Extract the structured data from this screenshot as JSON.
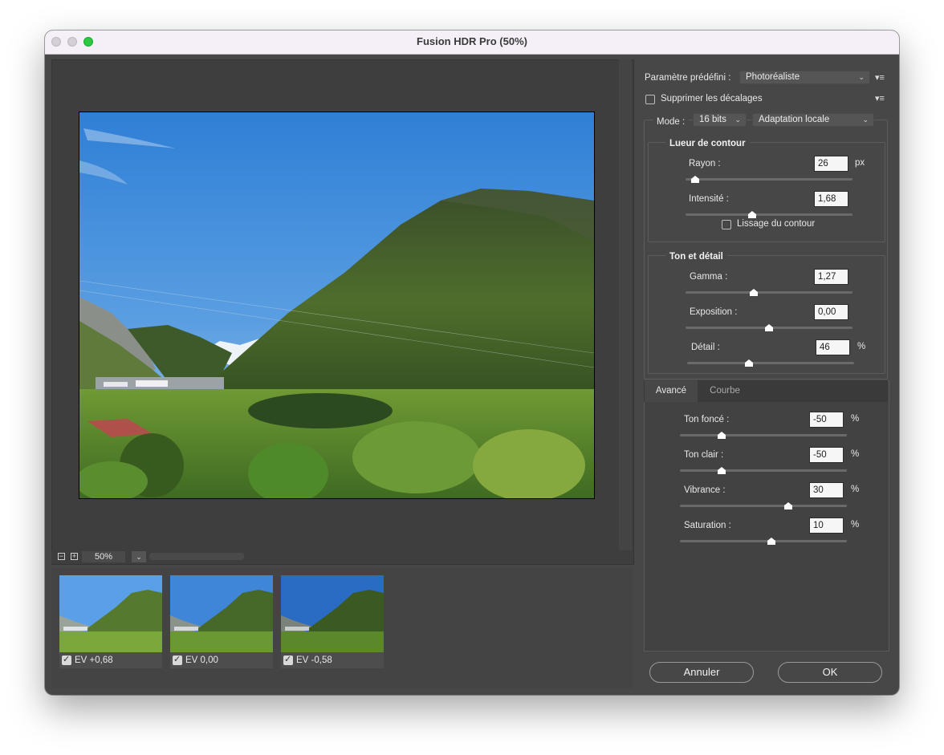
{
  "window": {
    "title": "Fusion HDR Pro (50%)"
  },
  "preview": {
    "zoom": "50%"
  },
  "thumbnails": [
    {
      "label": "EV +0,68",
      "checked": true
    },
    {
      "label": "EV 0,00",
      "checked": true
    },
    {
      "label": "EV -0,58",
      "checked": true
    }
  ],
  "preset": {
    "label": "Paramètre prédéfini :",
    "value": "Photoréaliste"
  },
  "remove_ghosts": {
    "label": "Supprimer les décalages",
    "checked": false
  },
  "mode": {
    "label": "Mode :",
    "bits": "16 bits",
    "method": "Adaptation locale"
  },
  "edge_glow": {
    "title": "Lueur de contour",
    "radius": {
      "label": "Rayon :",
      "value": "26",
      "unit": "px",
      "level": 0.06
    },
    "strength": {
      "label": "Intensité :",
      "value": "1,68",
      "level": 0.4
    },
    "smooth_label": "Lissage du contour",
    "smooth_checked": false
  },
  "tone_detail": {
    "title": "Ton et détail",
    "gamma": {
      "label": "Gamma :",
      "value": "1,27",
      "level": 0.41
    },
    "exposure": {
      "label": "Exposition :",
      "value": "0,00",
      "level": 0.5
    },
    "detail": {
      "label": "Détail :",
      "value": "46",
      "unit": "%",
      "level": 0.37
    }
  },
  "tabs": {
    "advanced": "Avancé",
    "curve": "Courbe"
  },
  "advanced": {
    "shadow": {
      "label": "Ton foncé :",
      "value": "-50",
      "unit": "%",
      "level": 0.25
    },
    "highlight": {
      "label": "Ton clair :",
      "value": "-50",
      "unit": "%",
      "level": 0.25
    },
    "vibrance": {
      "label": "Vibrance :",
      "value": "30",
      "unit": "%",
      "level": 0.65
    },
    "saturation": {
      "label": "Saturation :",
      "value": "10",
      "unit": "%",
      "level": 0.55
    }
  },
  "buttons": {
    "cancel": "Annuler",
    "ok": "OK"
  },
  "colors": {
    "panel": "#474747",
    "field": "#f6f6f6",
    "titlebar": "#f5f0f7"
  }
}
